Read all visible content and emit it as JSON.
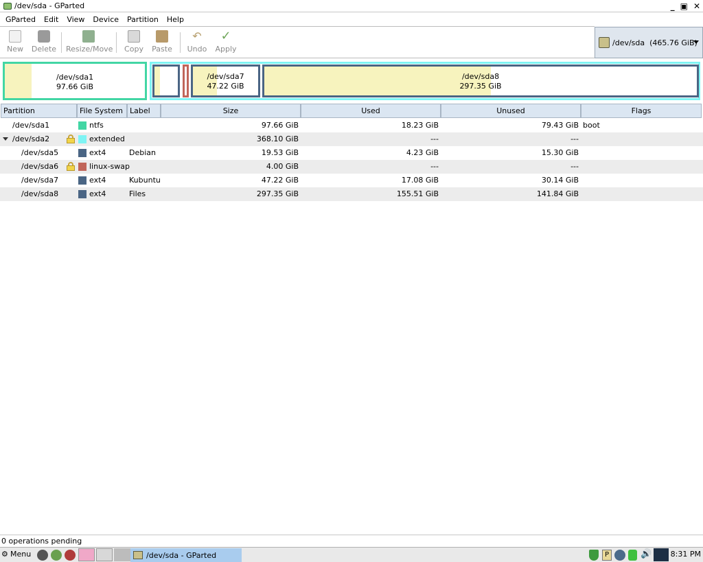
{
  "window": {
    "title": "/dev/sda - GParted"
  },
  "menu": [
    "GParted",
    "Edit",
    "View",
    "Device",
    "Partition",
    "Help"
  ],
  "toolbar": {
    "new": "New",
    "delete": "Delete",
    "resize_move": "Resize/Move",
    "copy": "Copy",
    "paste": "Paste",
    "undo": "Undo",
    "apply": "Apply"
  },
  "device_selector": {
    "text": "/dev/sda  (465.76 GiB)"
  },
  "disk_visual": {
    "sda1": {
      "name": "/dev/sda1",
      "size": "97.66 GiB"
    },
    "sda7": {
      "name": "/dev/sda7",
      "size": "47.22 GiB"
    },
    "sda8": {
      "name": "/dev/sda8",
      "size": "297.35 GiB"
    }
  },
  "columns": [
    "Partition",
    "File System",
    "Label",
    "Size",
    "Used",
    "Unused",
    "Flags"
  ],
  "rows": [
    {
      "partition": "/dev/sda1",
      "fs": "ntfs",
      "fs_color": "#42d6a4",
      "label": "",
      "size": "97.66 GiB",
      "used": "18.23 GiB",
      "unused": "79.43 GiB",
      "flags": "boot"
    },
    {
      "partition": "/dev/sda2",
      "fs": "extended",
      "fs_color": "#7ef4f4",
      "label": "",
      "size": "368.10 GiB",
      "used": "---",
      "unused": "---",
      "flags": ""
    },
    {
      "partition": "/dev/sda5",
      "fs": "ext4",
      "fs_color": "#4a6584",
      "label": "Debian",
      "size": "19.53 GiB",
      "used": "4.23 GiB",
      "unused": "15.30 GiB",
      "flags": ""
    },
    {
      "partition": "/dev/sda6",
      "fs": "linux-swap",
      "fs_color": "#c1665a",
      "label": "",
      "size": "4.00 GiB",
      "used": "---",
      "unused": "---",
      "flags": ""
    },
    {
      "partition": "/dev/sda7",
      "fs": "ext4",
      "fs_color": "#4a6584",
      "label": "Kubuntu",
      "size": "47.22 GiB",
      "used": "17.08 GiB",
      "unused": "30.14 GiB",
      "flags": ""
    },
    {
      "partition": "/dev/sda8",
      "fs": "ext4",
      "fs_color": "#4a6584",
      "label": "Files",
      "size": "297.35 GiB",
      "used": "155.51 GiB",
      "unused": "141.84 GiB",
      "flags": ""
    }
  ],
  "status": {
    "text": "0 operations pending"
  },
  "taskbar": {
    "menu_label": "Menu",
    "task_label": "/dev/sda - GParted",
    "clock": "8:31 PM"
  },
  "colors": {
    "header_bg": "#dbe6f2",
    "row_alt": "#ececec",
    "used_fill": "#f7f3be",
    "extended_border": "#7ef4f4",
    "ext4_border": "#4a6584",
    "ntfs_border": "#42d6a4",
    "swap_border": "#c1665a"
  }
}
